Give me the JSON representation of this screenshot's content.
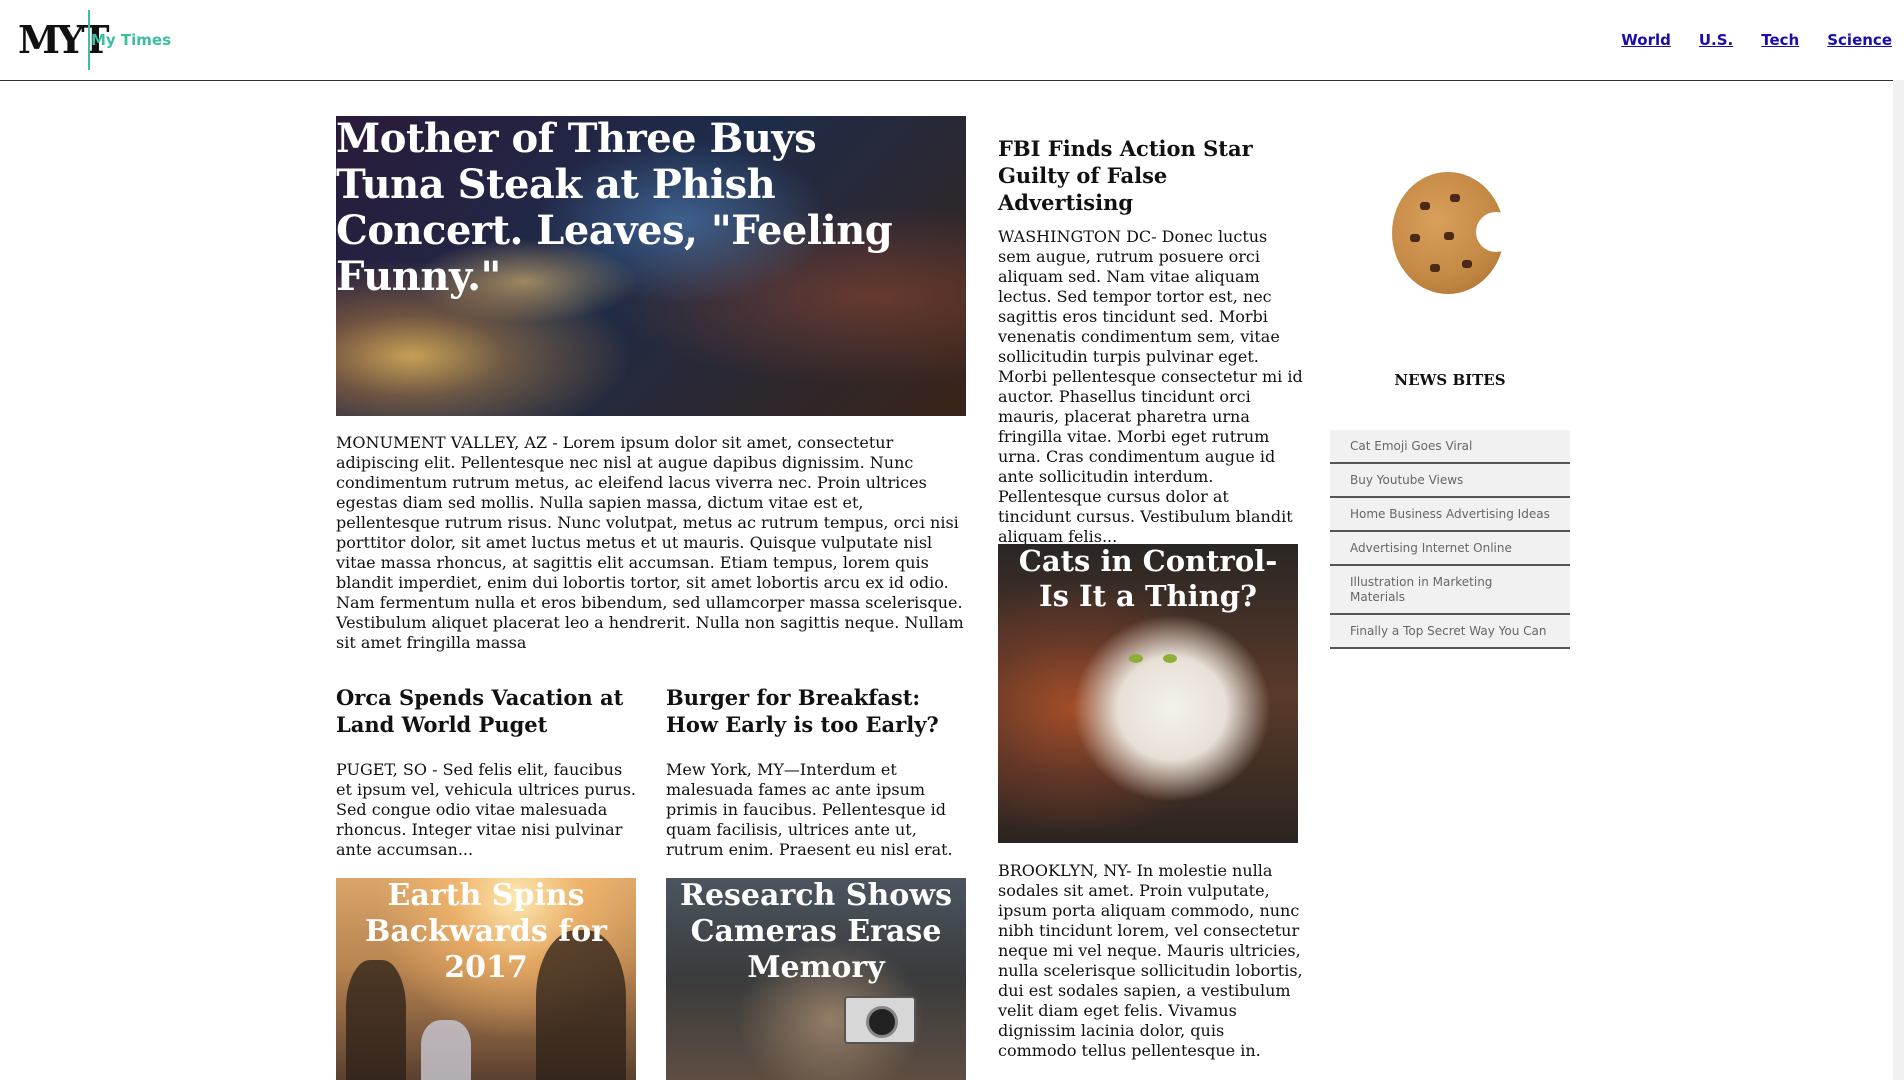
{
  "header": {
    "logo": "MYT",
    "site_name": "My Times",
    "nav": [
      "World",
      "U.S.",
      "Tech",
      "Science"
    ]
  },
  "hero": {
    "title": "Mother of Three Buys Tuna Steak at Phish Concert. Leaves, \"Feeling Funny.\"",
    "body": "MONUMENT VALLEY, AZ - Lorem ipsum dolor sit amet, consectetur adipiscing elit. Pellentesque nec nisl at augue dapibus dignissim. Nunc condimentum rutrum metus, ac eleifend lacus viverra nec. Proin ultrices egestas diam sed mollis. Nulla sapien massa, dictum vitae est et, pellentesque rutrum risus. Nunc volutpat, metus ac rutrum tempus, orci nisi porttitor dolor, sit amet luctus metus et ut mauris. Quisque vulputate nisl vitae massa rhoncus, at sagittis elit accumsan. Etiam tempus, lorem quis blandit imperdiet, enim dui lobortis tortor, sit amet lobortis arcu ex id odio. Nam fermentum nulla et eros bibendum, sed ullamcorper massa scelerisque. Vestibulum aliquet placerat leo a hendrerit. Nulla non sagittis neque. Nullam sit amet fringilla massa"
  },
  "articles": {
    "orca": {
      "title": "Orca Spends Vacation at Land World Puget",
      "body": "PUGET, SO - Sed felis elit, faucibus et ipsum vel, vehicula ultrices purus. Sed congue odio vitae malesuada rhoncus. Integer vitae nisi pulvinar ante accumsan..."
    },
    "burger": {
      "title": "Burger for Breakfast: How Early is too Early?",
      "body": "Mew York, MY—Interdum et malesuada fames ac ante ipsum primis in faucibus. Pellentesque id quam facilisis, ultrices ante ut, rutrum enim. Praesent eu nisl erat."
    },
    "fbi": {
      "title": "FBI Finds Action Star Guilty of False Advertising",
      "body": "WASHINGTON DC- Donec luctus sem augue, rutrum posuere orci aliquam sed. Nam vitae aliquam lectus. Sed tempor tortor est, nec sagittis eros tincidunt sed. Morbi venenatis condimentum sem, vitae sollicitudin turpis pulvinar eget. Morbi pellentesque consectetur mi id auctor. Phasellus tincidunt orci mauris, placerat pharetra urna fringilla vitae. Morbi eget rutrum urna. Cras condimentum augue id ante sollicitudin interdum. Pellentesque cursus dolor at tincidunt cursus. Vestibulum blandit aliquam felis..."
    },
    "brooklyn": {
      "body": "BROOKLYN, NY- In molestie nulla sodales sit amet. Proin vulputate, ipsum porta aliquam commodo, nunc nibh tincidunt lorem, vel consectetur neque mi vel neque. Mauris ultricies, nulla scelerisque sollicitudin lobortis, dui est sodales sapien, a vestibulum velit diam eget felis. Vivamus dignissim lacinia dolor, quis commodo tellus pellentesque in."
    }
  },
  "photos": {
    "cats": "Cats in Control-Is It a Thing?",
    "earth": "Earth Spins Backwards for 2017",
    "research": "Research Shows Cameras Erase Memory"
  },
  "sidebar": {
    "title": "NEWS BITES",
    "items": [
      "Cat Emoji Goes Viral",
      "Buy Youtube Views",
      "Home Business Advertising Ideas",
      "Advertising Internet Online",
      "Illustration in Marketing Materials",
      "Finally a Top Secret Way You Can"
    ]
  },
  "colors": {
    "accent": "#3bbf9f",
    "link": "#1a0dab",
    "sidebar_bg": "#f1f1f1"
  }
}
